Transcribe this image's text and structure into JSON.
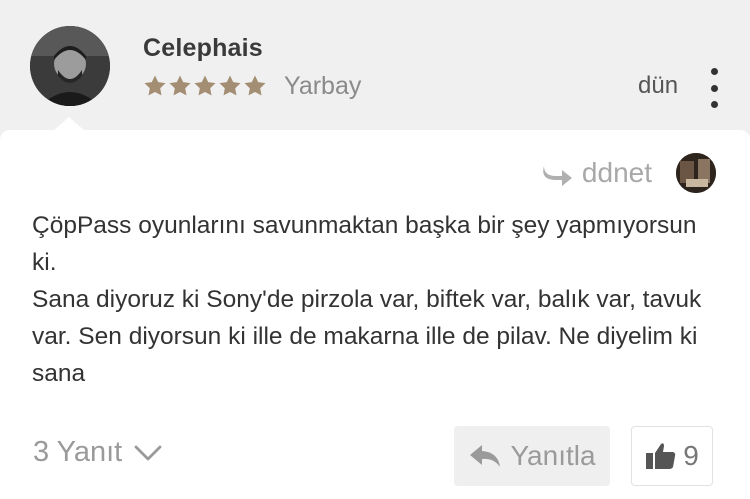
{
  "comment": {
    "author": "Celephais",
    "rank": "Yarbay",
    "stars": 5,
    "time": "dün",
    "reply_to": "ddnet",
    "body_lines": [
      "ÇöpPass oyunlarını savunmaktan başka bir şey yapmıyorsun ki.",
      "Sana diyoruz ki Sony'de pirzola var, biftek var, balık var, tavuk var. Sen diyorsun ki ille de makarna ille de pilav. Ne diyelim ki sana"
    ]
  },
  "actions": {
    "replies_label": "3 Yanıt",
    "reply_button": "Yanıtla",
    "like_count": "9"
  },
  "colors": {
    "star": "#a48e73",
    "background": "#f0f0f0",
    "card": "#ffffff"
  },
  "icons": [
    "more-vertical-icon",
    "reply-arrow-icon",
    "chevron-down-icon",
    "thumbs-up-icon",
    "star-icon"
  ]
}
